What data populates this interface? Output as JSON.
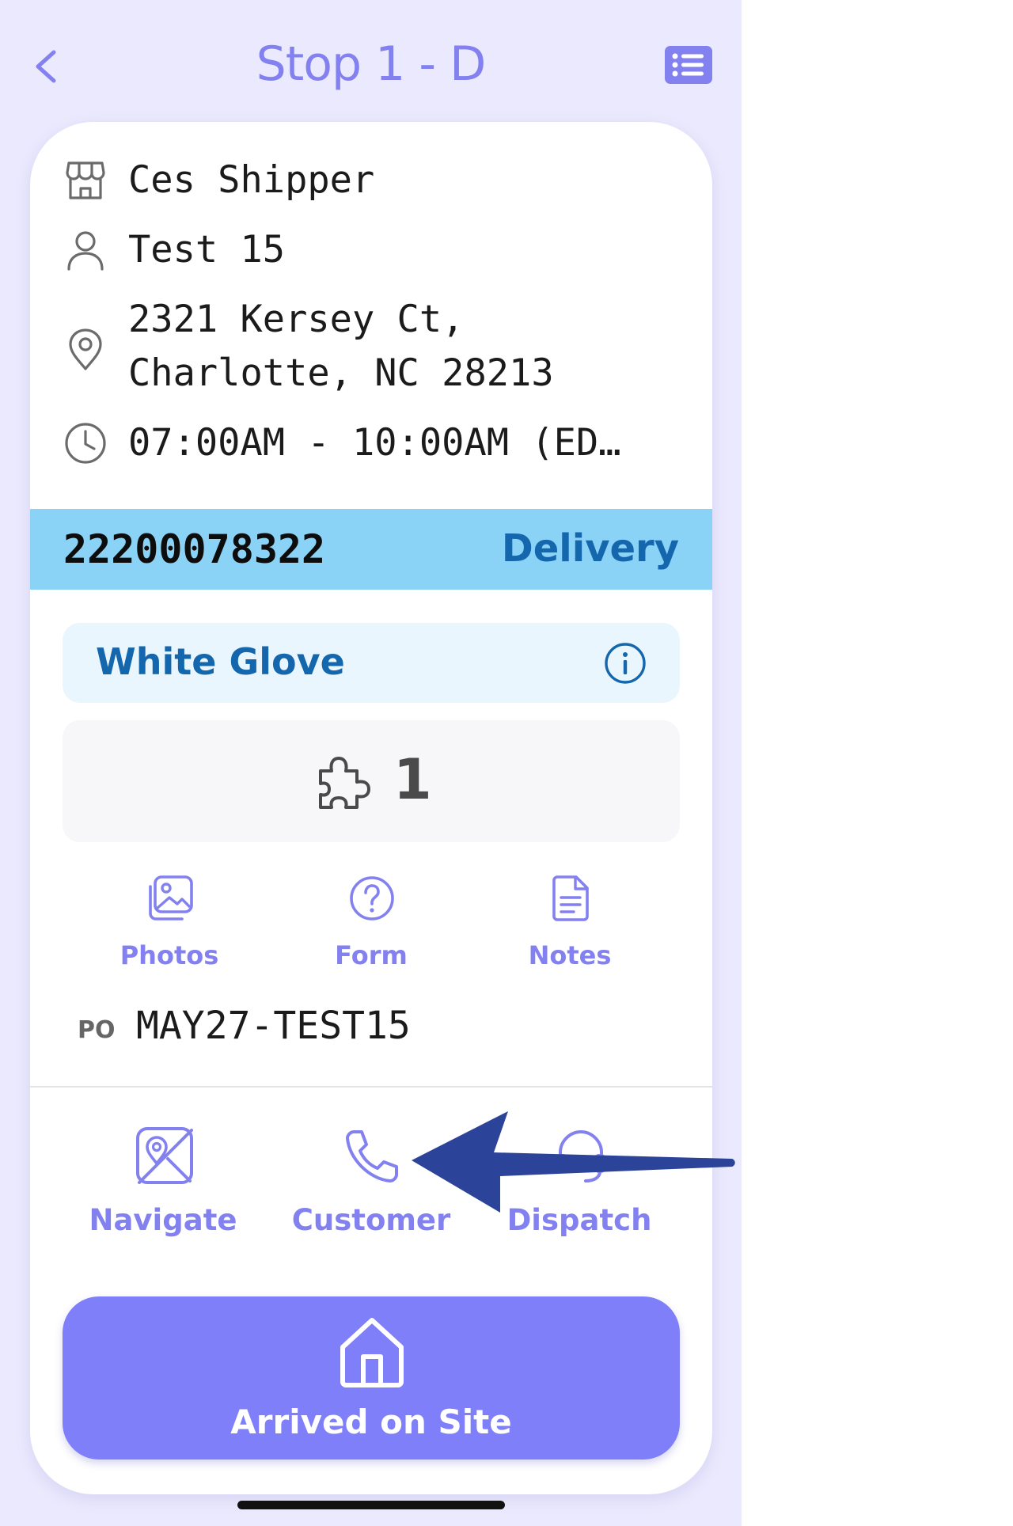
{
  "header": {
    "title": "Stop 1 - D",
    "back_icon": "chevron-left-icon",
    "menu_icon": "list-icon"
  },
  "stop": {
    "shipper": "Ces Shipper",
    "contact": "Test 15",
    "address_line1": "2321 Kersey Ct,",
    "address_line2": "Charlotte, NC 28213",
    "time_window": "07:00AM - 10:00AM (ED…"
  },
  "order": {
    "number": "22200078322",
    "type": "Delivery"
  },
  "service": {
    "level": "White Glove"
  },
  "pieces": {
    "count": "1"
  },
  "quick_actions": [
    {
      "label": "Photos",
      "icon": "photos-icon"
    },
    {
      "label": "Form",
      "icon": "help-circle-icon"
    },
    {
      "label": "Notes",
      "icon": "notes-icon"
    }
  ],
  "po": {
    "label": "PO",
    "value": "MAY27-TEST15"
  },
  "contact_actions": [
    {
      "label": "Navigate",
      "icon": "map-icon"
    },
    {
      "label": "Customer",
      "icon": "phone-icon"
    },
    {
      "label": "Dispatch",
      "icon": "headset-icon"
    }
  ],
  "primary_action": {
    "label": "Arrived on Site",
    "icon": "home-icon"
  },
  "colors": {
    "accent": "#7F7FFA",
    "accent_text": "#8281EF",
    "background": "#EBE9FD",
    "band": "#8AD3F6",
    "band_text": "#1466AD",
    "annotation_arrow": "#2B4499"
  }
}
